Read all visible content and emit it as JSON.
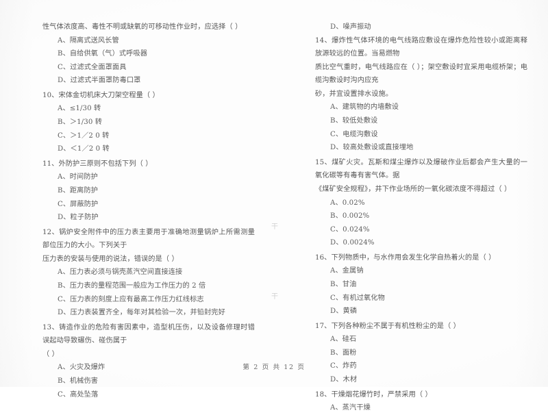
{
  "document": {
    "type": "scanned-exam-paper",
    "footer": "第 2 页 共 12 页",
    "page_number": "2",
    "total_pages": "12",
    "ink_color": "#5a5a5a",
    "paper_color": "#fdfdfd"
  },
  "left_column": {
    "carryover_stem": "性气体浓度高、毒性不明或缺氧的可移动性作业时，应选择（        ）",
    "questions": [
      {
        "number": "",
        "options": [
          "A、隔离式送风长管",
          "B、自给供氧（气）式呼吸器",
          "C、过滤式全面罩面具",
          "D、过滤式半面罩防毒口罩"
        ]
      },
      {
        "number": "10",
        "stem": "10、宋体金切机床大刀架空程量（        ）",
        "options": [
          "A、≤1/30 转",
          "B、＞1/30 转",
          "C、＞1／2 0 转",
          "D、＜1／2 0 转"
        ]
      },
      {
        "number": "11",
        "stem": "11、外防护三原则不包括下列（        ）",
        "options": [
          "A、时间防护",
          "B、距离防护",
          "C、屏蔽防护",
          "D、粒子防护"
        ]
      },
      {
        "number": "12",
        "stem": "12、锅炉安全附件中的压力表主要用于准确地测量锅炉上所需测量部位压力的大小。下列关于",
        "stem_line2": "压力表的安装与使用的说法，错误的是（        ）",
        "options": [
          "A、压力表必须与锅壳蒸汽空间直接连接",
          "B、压力表的量程范围一般应为工作压力的 2 倍",
          "C、压力表的刻度上应有最高工作压力红线标志",
          "D、压力表装置齐全，每年对其检验一次，并铅封完好"
        ]
      },
      {
        "number": "13",
        "stem": "13、铸造作业的危险有害因素中，造型机压伤，以及设备修理时错误起动导致碾伤、碰伤属于",
        "stem_line2": "（        ）",
        "options": [
          "A、火灾及爆炸",
          "B、机械伤害",
          "C、高处坠落"
        ]
      }
    ]
  },
  "right_column": {
    "carryover_option": "D、噪声振动",
    "questions": [
      {
        "number": "14",
        "stem": "14、爆炸性气体环境的电气线路应敷设在爆炸危险性较小或距离释放源较远的位置。当易燃物",
        "stem_line2": "质比空气重时，电气线路应在（        ）；架空敷设时宜采用电缆桥架；电缆沟敷设时沟内应充",
        "stem_line3": "砂，并宜设置排水设施。",
        "options": [
          "A、建筑物的内墙敷设",
          "B、较低处敷设",
          "C、电缆沟敷设",
          "D、较高处敷设或直接埋地"
        ]
      },
      {
        "number": "15",
        "stem": "15、煤矿火灾。瓦斯和煤尘爆炸以及爆破作业后都会产生大量的一氧化碳等有毒有害气体。据",
        "stem_line2": "《煤矿安全规程》，井下作业场所的一氧化碳浓度不得超过（        ）",
        "options": [
          "A、0.02%",
          "B、0.002%",
          "C、0.024%",
          "D、0.0024%"
        ]
      },
      {
        "number": "16",
        "stem": "16、下列物质中，与水作用会发生化学自热着火的是（        ）",
        "options": [
          "A、金属钠",
          "B、甘油",
          "C、有机过氧化物",
          "D、黄磷"
        ]
      },
      {
        "number": "17",
        "stem": "17、下列各种粉尘不属于有机性粉尘的是（        ）",
        "options": [
          "A、硅石",
          "B、面粉",
          "C、炸药",
          "D、木材"
        ]
      },
      {
        "number": "18",
        "stem": "18、干燥烟花爆竹时，严禁采用（        ）",
        "options": [
          "A、蒸汽干燥"
        ]
      }
    ]
  },
  "artifacts": {
    "bleed_marks": [
      "干",
      "干",
      "丁"
    ]
  }
}
